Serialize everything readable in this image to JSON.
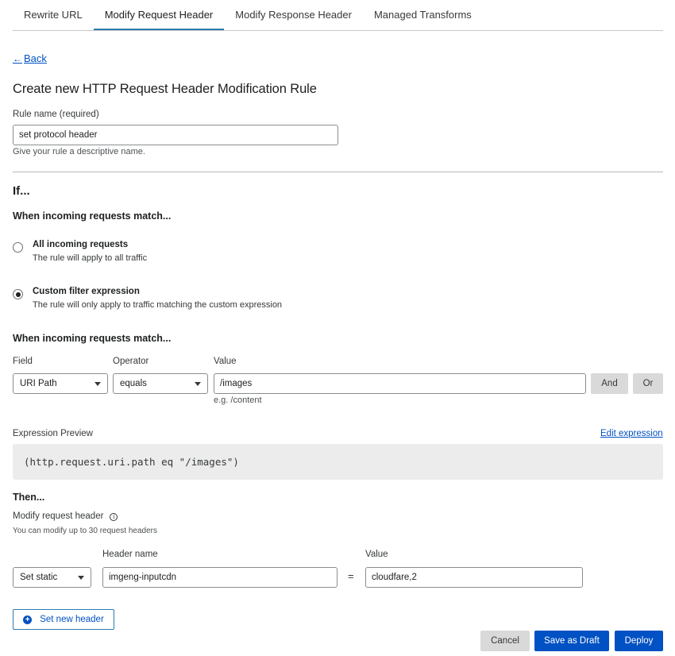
{
  "tabs": [
    {
      "label": "Rewrite URL"
    },
    {
      "label": "Modify Request Header"
    },
    {
      "label": "Modify Response Header"
    },
    {
      "label": "Managed Transforms"
    }
  ],
  "back_label": "Back",
  "page_title": "Create new HTTP Request Header Modification Rule",
  "rule_name": {
    "label": "Rule name (required)",
    "value": "set protocol header",
    "hint": "Give your rule a descriptive name."
  },
  "if_heading": "If...",
  "match_heading": "When incoming requests match...",
  "radios": [
    {
      "title": "All incoming requests",
      "desc": "The rule will apply to all traffic",
      "checked": false
    },
    {
      "title": "Custom filter expression",
      "desc": "The rule will only apply to traffic matching the custom expression",
      "checked": true
    }
  ],
  "match_heading_2": "When incoming requests match...",
  "filter": {
    "field_label": "Field",
    "field_value": "URI Path",
    "operator_label": "Operator",
    "operator_value": "equals",
    "value_label": "Value",
    "value_value": "/images",
    "value_hint": "e.g. /content",
    "and_label": "And",
    "or_label": "Or"
  },
  "expression": {
    "label": "Expression Preview",
    "edit_label": "Edit expression",
    "text": "(http.request.uri.path eq \"/images\")"
  },
  "then_heading": "Then...",
  "modify": {
    "label": "Modify request header",
    "hint": "You can modify up to 30 request headers",
    "action_value": "Set static",
    "header_name_label": "Header name",
    "header_name_value": "imgeng-inputcdn",
    "equals_sign": "=",
    "value_label": "Value",
    "value_value": "cloudfare,2"
  },
  "set_new_header_label": "Set new header",
  "footer": {
    "cancel_label": "Cancel",
    "save_draft_label": "Save as Draft",
    "deploy_label": "Deploy"
  },
  "colors": {
    "accent": "#0051c3",
    "tab_underline": "#2c7cb0",
    "gray_button": "#d9d9d9",
    "expression_bg": "#ececec"
  }
}
